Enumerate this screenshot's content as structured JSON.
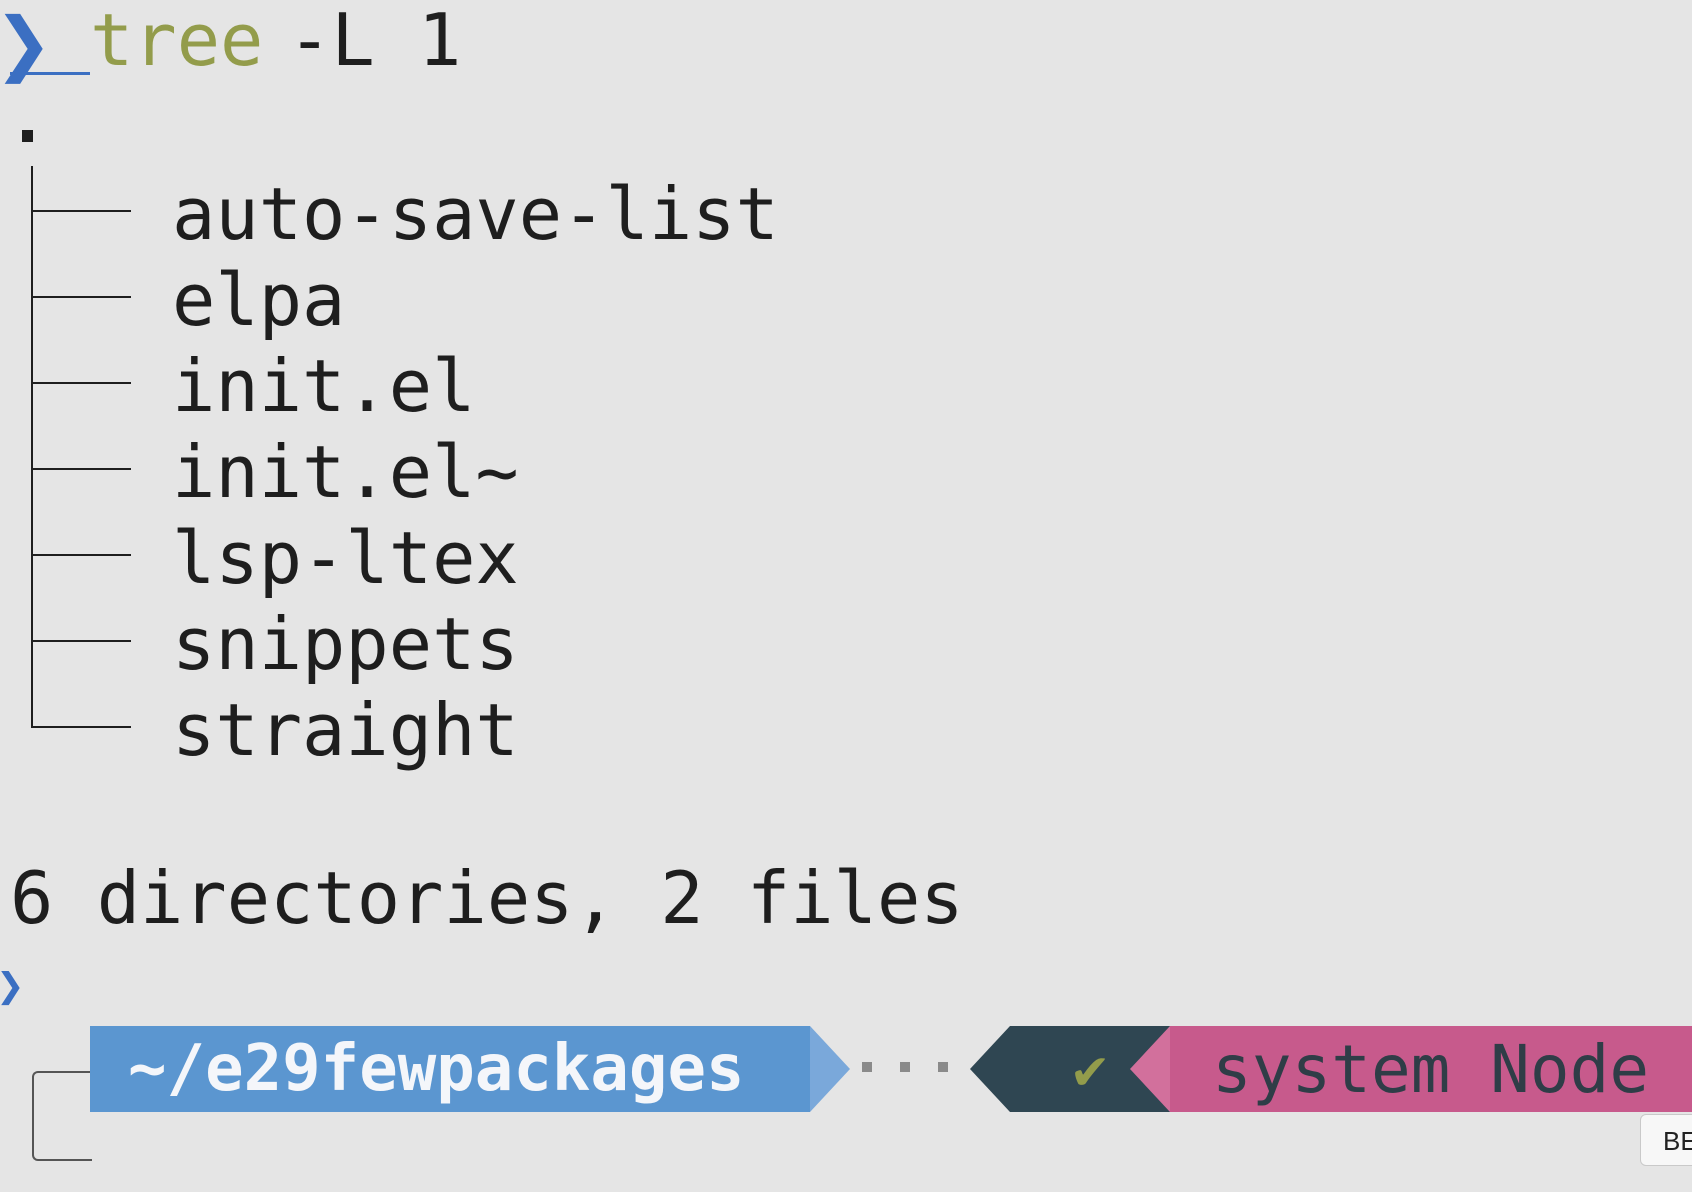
{
  "prompt": {
    "symbol": "❯",
    "command": "tree",
    "args": "-L 1"
  },
  "tree": {
    "root": ".",
    "items": [
      "auto-save-list",
      "elpa",
      "init.el",
      "init.el~",
      "lsp-ltex",
      "snippets",
      "straight"
    ]
  },
  "summary": "6 directories, 2 files",
  "powerline": {
    "path": "~/e29fewpackages",
    "status_icon": "check-icon",
    "status_glyph": "✔",
    "node": "system Node",
    "colors": {
      "path_bg": "#5b96d0",
      "status_bg": "#2f4652",
      "node_bg": "#c75a8c",
      "command": "#939c4b",
      "prompt": "#3b6fc2"
    }
  },
  "corner_button": "BE"
}
